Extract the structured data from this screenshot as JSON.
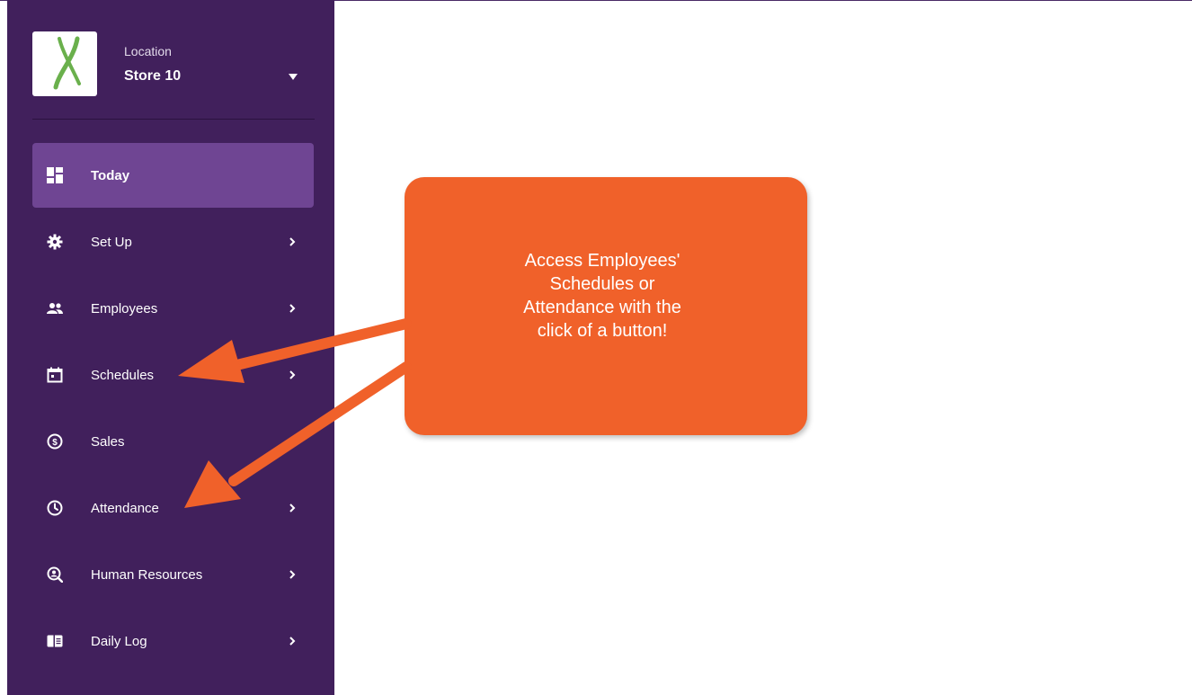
{
  "sidebar": {
    "location": {
      "label": "Location",
      "value": "Store 10",
      "caret_icon": "caret-down-icon"
    },
    "nav_items": [
      {
        "label": "Today",
        "icon": "dashboard-icon",
        "active": true,
        "has_chevron": false
      },
      {
        "label": "Set Up",
        "icon": "gear-icon",
        "active": false,
        "has_chevron": true
      },
      {
        "label": "Employees",
        "icon": "people-icon",
        "active": false,
        "has_chevron": true
      },
      {
        "label": "Schedules",
        "icon": "calendar-icon",
        "active": false,
        "has_chevron": true
      },
      {
        "label": "Sales",
        "icon": "dollar-circle-icon",
        "active": false,
        "has_chevron": false
      },
      {
        "label": "Attendance",
        "icon": "clock-icon",
        "active": false,
        "has_chevron": true
      },
      {
        "label": "Human Resources",
        "icon": "person-search-icon",
        "active": false,
        "has_chevron": true
      },
      {
        "label": "Daily Log",
        "icon": "log-book-icon",
        "active": false,
        "has_chevron": true
      }
    ]
  },
  "callout": {
    "text": "Access Employees'\nSchedules or\nAttendance with the\nclick of a button!"
  },
  "colors": {
    "sidebar_bg": "#41205c",
    "active_item_bg": "#6f4593",
    "callout_bg": "#f0612a",
    "logo_green": "#6ab04c"
  }
}
